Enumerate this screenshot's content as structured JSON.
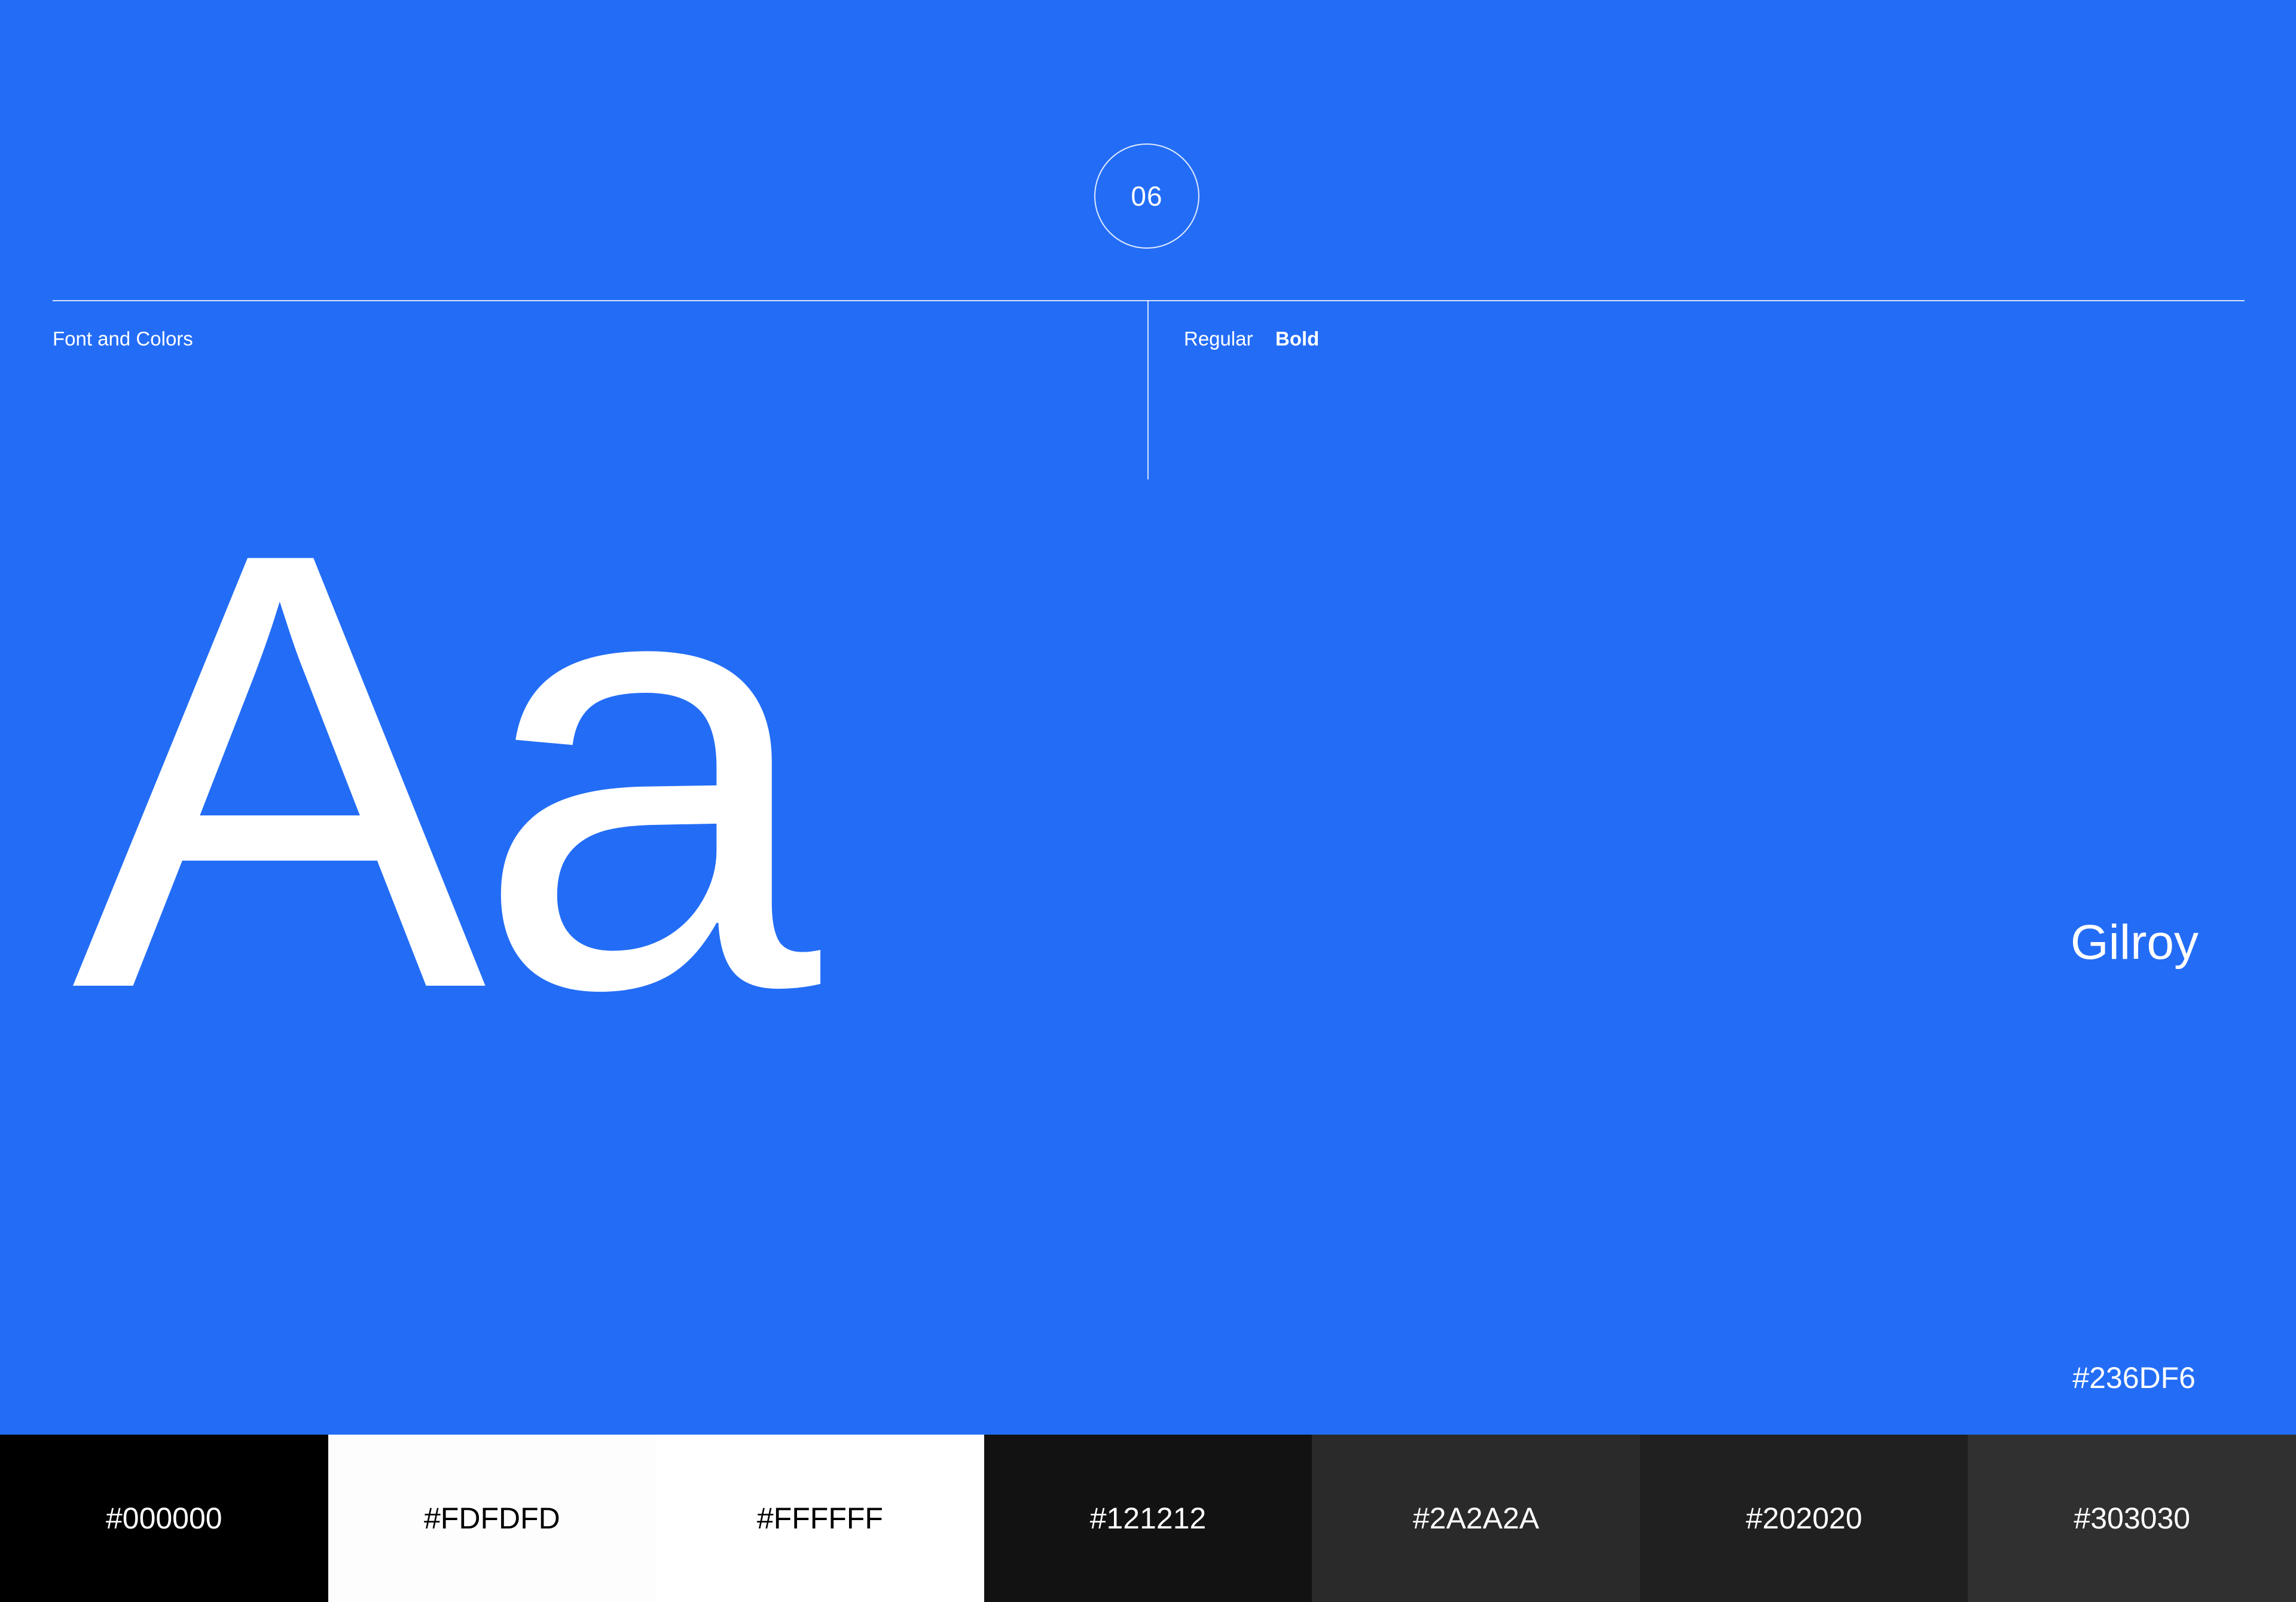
{
  "page_number": "06",
  "section_label": "Font and Colors",
  "font_weights": {
    "regular": "Regular",
    "bold": "Bold"
  },
  "specimen": "Aa",
  "font_name": "Gilroy",
  "primary_color": {
    "hex": "#236DF6",
    "label": "#236DF6"
  },
  "swatches": [
    {
      "label": "#000000",
      "color": "#000000",
      "text_color": "#ffffff"
    },
    {
      "label": "#FDFDFD",
      "color": "#FDFDFD",
      "text_color": "#000000"
    },
    {
      "label": "#FFFFFF",
      "color": "#FFFFFF",
      "text_color": "#000000"
    },
    {
      "label": "#121212",
      "color": "#121212",
      "text_color": "#ffffff"
    },
    {
      "label": "#2A2A2A",
      "color": "#2A2A2A",
      "text_color": "#ffffff"
    },
    {
      "label": "#202020",
      "color": "#202020",
      "text_color": "#ffffff"
    },
    {
      "label": "#303030",
      "color": "#303030",
      "text_color": "#ffffff"
    }
  ]
}
